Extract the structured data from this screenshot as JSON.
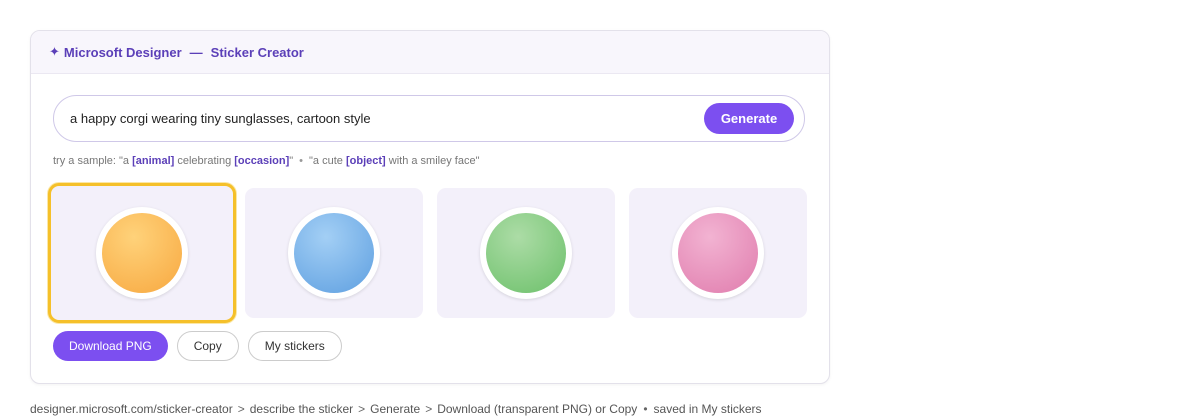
{
  "header": {
    "sparkle": "✦",
    "app_name": "Microsoft Designer",
    "separator": "—",
    "feature": "Sticker Creator"
  },
  "prompt": {
    "value": "a happy corgi wearing tiny sunglasses, cartoon style",
    "generate_label": "Generate"
  },
  "samples": {
    "intro": "try a sample: ",
    "s1_open": "\"a ",
    "s1_ph1": "[animal]",
    "s1_mid": " celebrating ",
    "s1_ph2": "[occasion]",
    "s1_close": "\"",
    "dot": "•",
    "s2_open": "\"a cute ",
    "s2_ph1": "[object]",
    "s2_close": " with a smiley face\""
  },
  "stickers": [
    {
      "color": "orange",
      "selected": true
    },
    {
      "color": "blue",
      "selected": false
    },
    {
      "color": "green",
      "selected": false
    },
    {
      "color": "pink",
      "selected": false
    }
  ],
  "actions": {
    "download_label": "Download PNG",
    "copy_label": "Copy",
    "my_stickers_label": "My stickers"
  },
  "footer": {
    "url": "designer.microsoft.com/sticker-creator",
    "arrow": ">",
    "step1": "describe the sticker",
    "step2": "Generate",
    "step3": "Download (transparent PNG) or Copy",
    "bullet": "•",
    "note": "saved in My stickers"
  },
  "colors": {
    "accent": "#7c4ff0",
    "header_text": "#5b3fb8",
    "selected_border": "#f5c02a",
    "tile_bg": "#f3f0fa"
  }
}
